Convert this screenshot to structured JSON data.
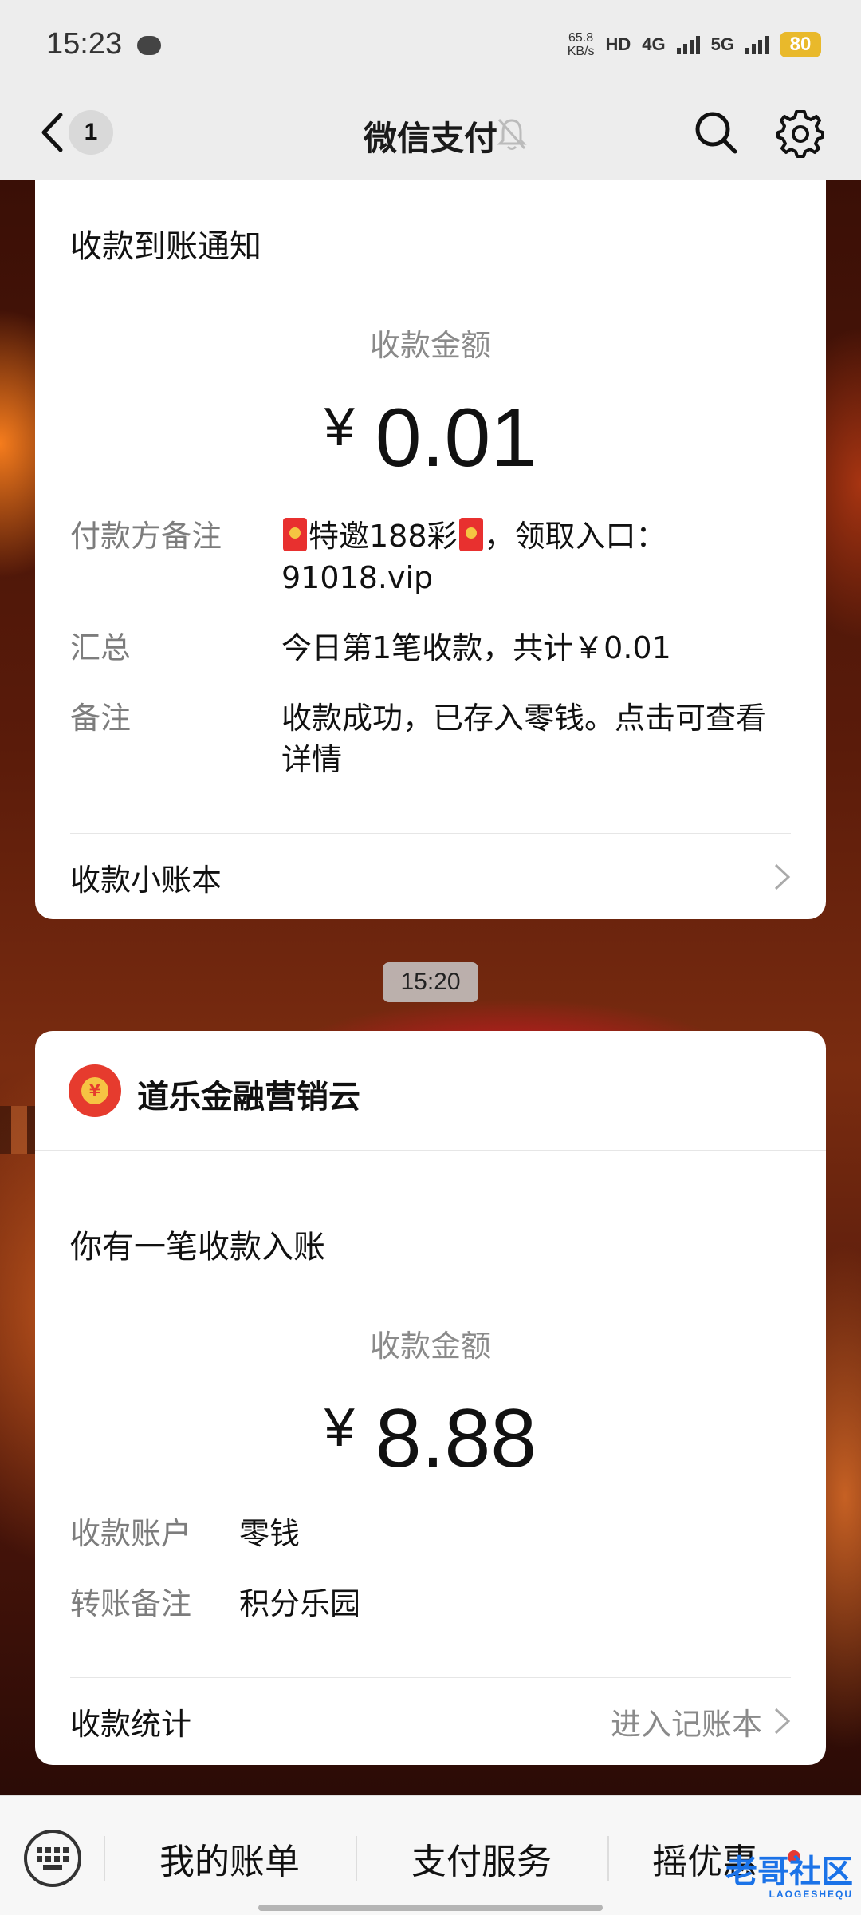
{
  "status_bar": {
    "time": "15:23",
    "speed_value": "65.8",
    "speed_unit": "KB/s",
    "hd_label": "HD",
    "network_4g": "4G",
    "network_5g": "5G",
    "battery": "80"
  },
  "nav": {
    "unread_count": "1",
    "title": "微信支付"
  },
  "card1": {
    "title": "收款到账通知",
    "amount_label": "收款金额",
    "currency": "¥",
    "amount": "0.01",
    "rows": [
      {
        "key": "付款方备注",
        "value_pre": "特邀188彩",
        "value_post": "，领取入口：91018.vip"
      },
      {
        "key": "汇总",
        "value": "今日第1笔收款，共计￥0.01"
      },
      {
        "key": "备注",
        "value": "收款成功，已存入零钱。点击可查看详情"
      }
    ],
    "footer_label": "收款小账本"
  },
  "timestamp": "15:20",
  "card2": {
    "sender": "道乐金融营销云",
    "logo_glyph": "¥",
    "title": "你有一笔收款入账",
    "amount_label": "收款金额",
    "currency": "¥",
    "amount": "8.88",
    "rows": [
      {
        "key": "收款账户",
        "value": "零钱"
      },
      {
        "key": "转账备注",
        "value": "积分乐园"
      }
    ],
    "footer_label": "收款统计",
    "footer_link": "进入记账本"
  },
  "bottom_bar": {
    "tabs": [
      "我的账单",
      "支付服务",
      "摇优惠"
    ],
    "watermark": "老哥社区",
    "watermark_sub": "LAOGESHEQU"
  },
  "colors": {
    "accent_red": "#e63b2e",
    "battery": "#e9b92b",
    "watermark_blue": "#1b73e8"
  },
  "icons": [
    "back-arrow-icon",
    "mute-bell-icon",
    "search-icon",
    "gear-icon",
    "chevron-right-icon",
    "red-packet-icon",
    "keyboard-icon"
  ]
}
